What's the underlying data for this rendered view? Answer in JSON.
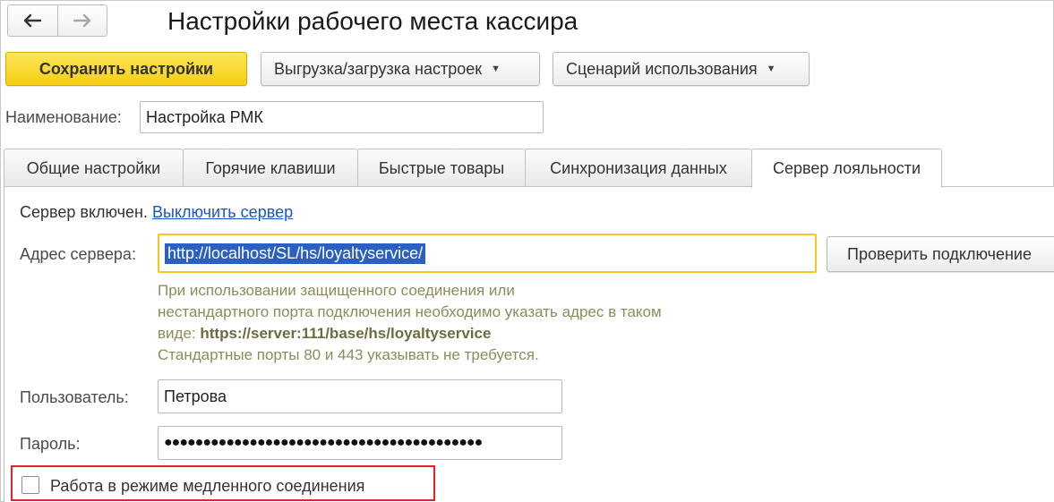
{
  "window": {
    "title": "Настройки рабочего места кассира"
  },
  "nav": {
    "back_icon": "arrow-left-icon",
    "forward_icon": "arrow-right-icon"
  },
  "toolbar": {
    "save_label": "Сохранить настройки",
    "export_import_label": "Выгрузка/загрузка настроек",
    "scenario_label": "Сценарий использования"
  },
  "name_field": {
    "label": "Наименование:",
    "value": "Настройка РМК"
  },
  "tabs": [
    {
      "label": "Общие настройки"
    },
    {
      "label": "Горячие клавиши"
    },
    {
      "label": "Быстрые товары"
    },
    {
      "label": "Синхронизация данных"
    },
    {
      "label": "Сервер лояльности",
      "active": true
    }
  ],
  "server": {
    "status_text": "Сервер включен.",
    "disable_link": "Выключить сервер",
    "address_label": "Адрес сервера:",
    "address_value": "http://localhost/SL/hs/loyaltyservice/",
    "check_button": "Проверить подключение",
    "hint_line1": "При использовании защищенного соединения или",
    "hint_line2": "нестандартного порта подключения необходимо указать адрес в таком",
    "hint_line3_prefix": "виде: ",
    "hint_line3_example": "https://server:111/base/hs/loyaltyservice",
    "hint_line4": "Стандартные порты 80 и 443 указывать не требуется."
  },
  "user": {
    "label": "Пользователь:",
    "value": "Петрова"
  },
  "password": {
    "label": "Пароль:",
    "value": "●●●●●●●●●●●●●●●●●●●●●●●●●●●●●●●●●●●●●●●●●"
  },
  "slow_mode": {
    "label": "Работа в режиме медленного соединения",
    "checked": false
  },
  "colors": {
    "primary_button": "#f5cf12",
    "highlight_border": "#e3222b",
    "url_field_border": "#f2c81e",
    "link": "#1a55c8"
  }
}
